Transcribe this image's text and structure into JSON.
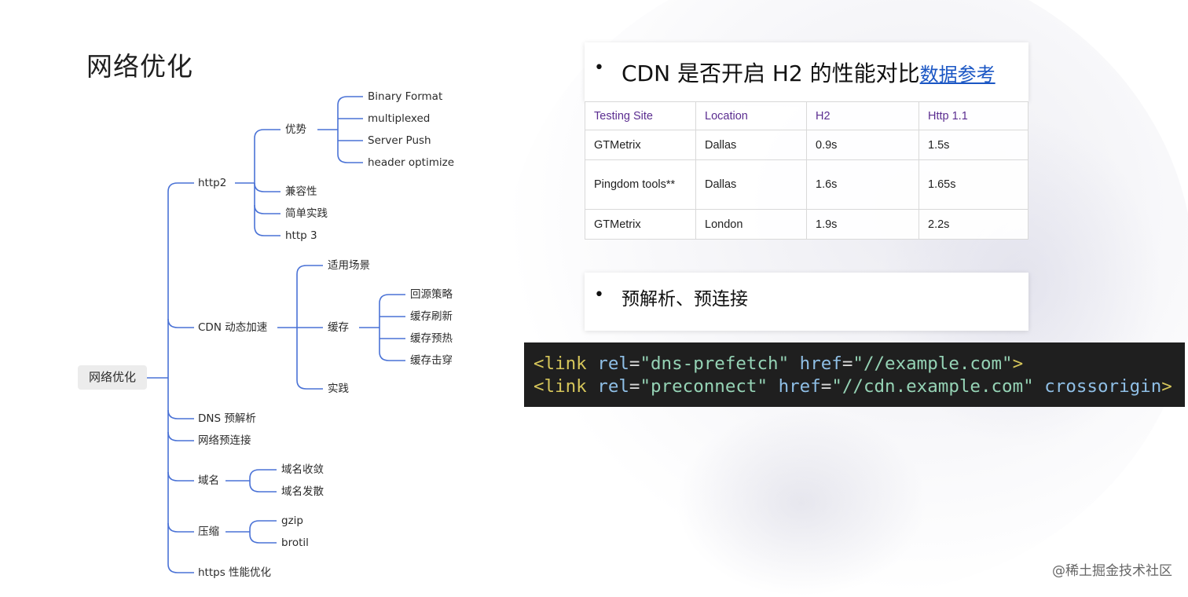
{
  "slide": {
    "title": "网络优化"
  },
  "mindmap": {
    "root": "网络优化",
    "http2": {
      "label": "http2",
      "advantage": {
        "label": "优势",
        "items": [
          "Binary Format",
          "multiplexed",
          "Server Push",
          "header optimize"
        ]
      },
      "others": [
        "兼容性",
        "简单实践",
        "http 3"
      ]
    },
    "cdn": {
      "label": "CDN 动态加速",
      "scenario": "适用场景",
      "cache": {
        "label": "缓存",
        "items": [
          "回源策略",
          "缓存刷新",
          "缓存预热",
          "缓存击穿"
        ]
      },
      "practice": "实践"
    },
    "dns": "DNS 预解析",
    "preconnect": "网络预连接",
    "domain": {
      "label": "域名",
      "items": [
        "域名收敛",
        "域名发散"
      ]
    },
    "compress": {
      "label": "压缩",
      "items": [
        "gzip",
        "brotil"
      ]
    },
    "https": "https 性能优化"
  },
  "cdn_compare": {
    "bullet": "•",
    "heading": "CDN 是否开启 H2 的性能对比",
    "link_label": "数据参考",
    "table": {
      "headers": [
        "Testing Site",
        "Location",
        "H2",
        "Http 1.1"
      ],
      "rows": [
        [
          "GTMetrix",
          "Dallas",
          "0.9s",
          "1.5s"
        ],
        [
          "Pingdom tools**",
          "Dallas",
          "1.6s",
          "1.65s"
        ],
        [
          "GTMetrix",
          "London",
          "1.9s",
          "2.2s"
        ]
      ]
    }
  },
  "prefetch": {
    "bullet": "•",
    "heading": "预解析、预连接"
  },
  "code": {
    "line1": {
      "open": "<link",
      "attr1": "rel",
      "eq": "=",
      "val1": "\"dns-prefetch\"",
      "attr2": "href",
      "val2": "\"//example.com\"",
      "close": ">"
    },
    "line2": {
      "open": "<link",
      "attr1": "rel",
      "eq": "=",
      "val1": "\"preconnect\"",
      "attr2": "href",
      "val2": "\"//cdn.example.com\"",
      "attr3": "crossorigin",
      "close": ">"
    }
  },
  "footer": {
    "watermark": "@稀土掘金技术社区"
  },
  "colors": {
    "connector": "#4a72d6",
    "table_header": "#5b2d90",
    "link": "#1a56c4",
    "code_bg": "#1f1f1f"
  }
}
